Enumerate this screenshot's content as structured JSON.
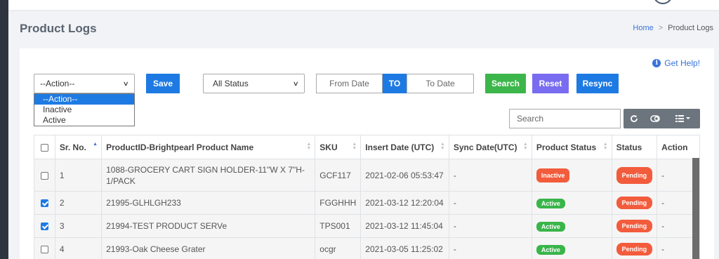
{
  "page": {
    "title": "Product Logs",
    "breadcrumb": {
      "home": "Home",
      "current": "Product Logs"
    }
  },
  "help": {
    "icon": "info-icon",
    "label": "Get Help!"
  },
  "toolbar": {
    "action_select": {
      "value": "--Action--",
      "options": [
        "--Action--",
        "Inactive",
        "Active"
      ]
    },
    "save_label": "Save",
    "status_select": {
      "value": "All Status"
    },
    "from_date_placeholder": "From Date",
    "to_badge": "TO",
    "to_date_placeholder": "To Date",
    "search_label": "Search",
    "reset_label": "Reset",
    "resync_label": "Resync",
    "colors": {
      "save": "#1e7ae3",
      "search": "#3cb64a",
      "reset": "#7a6cf0",
      "resync": "#1e7ae3"
    }
  },
  "table_search": {
    "placeholder": "Search"
  },
  "table_tools": [
    "refresh-icon",
    "toggle-icon",
    "columns-icon"
  ],
  "table": {
    "headers": [
      "Sr. No.",
      "ProductID-Brightpearl Product Name",
      "SKU",
      "Insert Date (UTC)",
      "Sync Date(UTC)",
      "Product Status",
      "Status",
      "Action"
    ],
    "rows": [
      {
        "checked": false,
        "sr": "1",
        "name": "1088-GROCERY CART SIGN HOLDER-11\"W X 7\"H-1/PACK",
        "sku": "GCF117",
        "insert": "2021-02-06 05:53:47",
        "sync": "-",
        "product_status": "Inactive",
        "status": "Pending",
        "action": "-"
      },
      {
        "checked": true,
        "sr": "2",
        "name": "21995-GLHLGH233",
        "sku": "FGGHHH",
        "insert": "2021-03-12 12:20:04",
        "sync": "-",
        "product_status": "Active",
        "status": "Pending",
        "action": "-"
      },
      {
        "checked": true,
        "sr": "3",
        "name": "21994-TEST PRODUCT SERVe",
        "sku": "TPS001",
        "insert": "2021-03-12 11:45:04",
        "sync": "-",
        "product_status": "Active",
        "status": "Pending",
        "action": "-"
      },
      {
        "checked": false,
        "sr": "4",
        "name": "21993-Oak Cheese Grater",
        "sku": "ocgr",
        "insert": "2021-03-05 11:25:02",
        "sync": "-",
        "product_status": "Active",
        "status": "Pending",
        "action": "-"
      }
    ]
  }
}
